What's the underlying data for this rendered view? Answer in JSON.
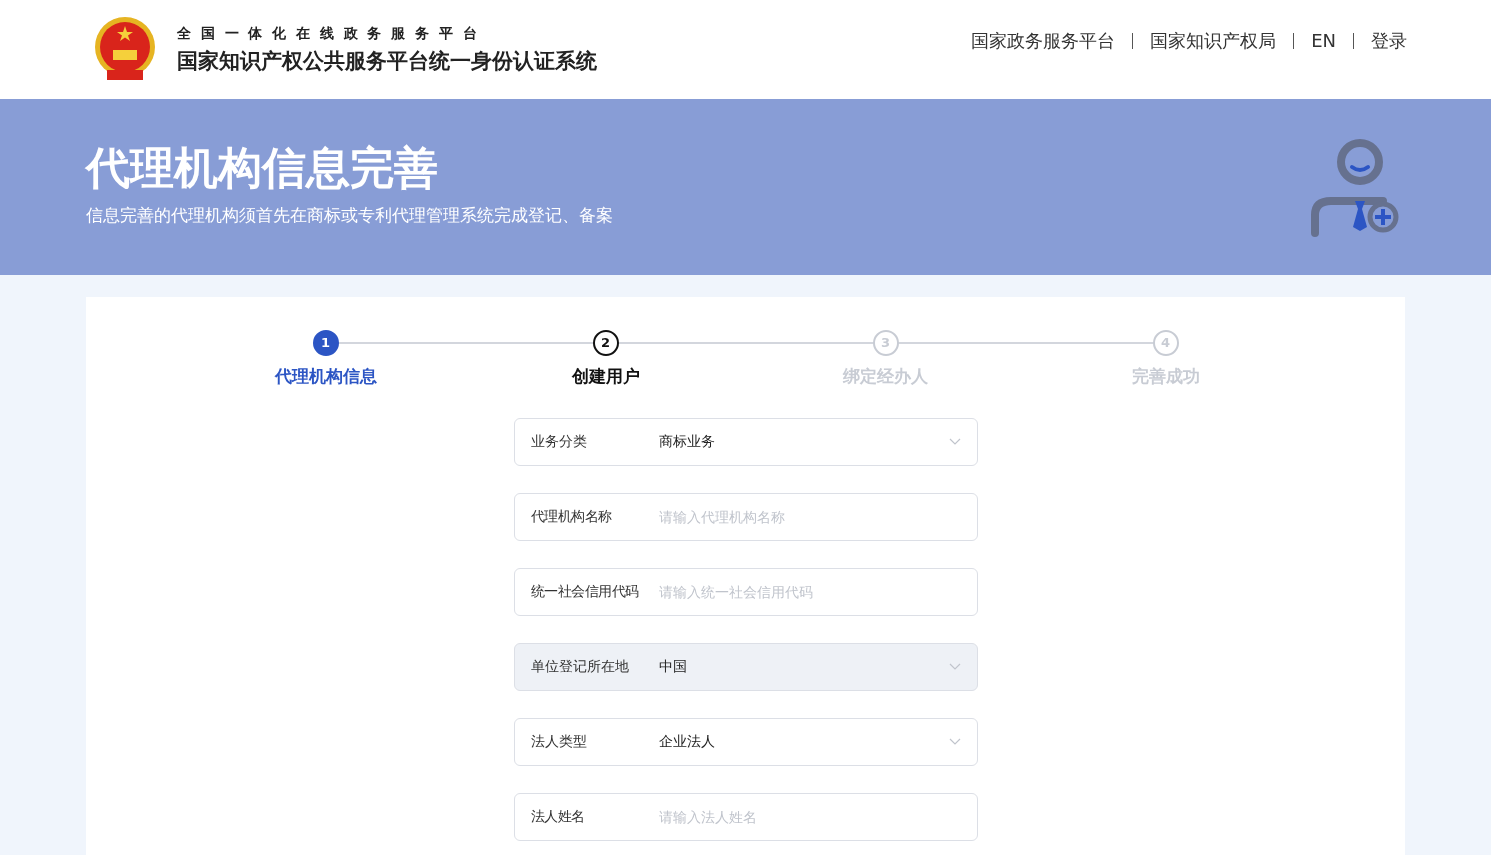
{
  "header": {
    "subtitle": "全国一体化在线政务服务平台",
    "title": "国家知识产权公共服务平台统一身份认证系统",
    "links": [
      "国家政务服务平台",
      "国家知识产权局",
      "EN",
      "登录"
    ]
  },
  "banner": {
    "title": "代理机构信息完善",
    "description": "信息完善的代理机构须首先在商标或专利代理管理系统完成登记、备案"
  },
  "steps": [
    {
      "number": "1",
      "label": "代理机构信息",
      "done": true,
      "selected": false
    },
    {
      "number": "2",
      "label": "创建用户",
      "done": false,
      "selected": true
    },
    {
      "number": "3",
      "label": "绑定经办人",
      "done": false,
      "selected": false
    },
    {
      "number": "4",
      "label": "完善成功",
      "done": false,
      "selected": false
    }
  ],
  "form": [
    {
      "kind": "select",
      "label": "业务分类",
      "value": "商标业务",
      "disabled": false
    },
    {
      "kind": "input",
      "label": "代理机构名称",
      "placeholder": "请输入代理机构名称",
      "disabled": false
    },
    {
      "kind": "input",
      "label": "统一社会信用代码",
      "placeholder": "请输入统一社会信用代码",
      "disabled": false
    },
    {
      "kind": "select",
      "label": "单位登记所在地",
      "value": "中国",
      "disabled": true
    },
    {
      "kind": "select",
      "label": "法人类型",
      "value": "企业法人",
      "disabled": false
    },
    {
      "kind": "input",
      "label": "法人姓名",
      "placeholder": "请输入法人姓名",
      "disabled": false
    }
  ]
}
